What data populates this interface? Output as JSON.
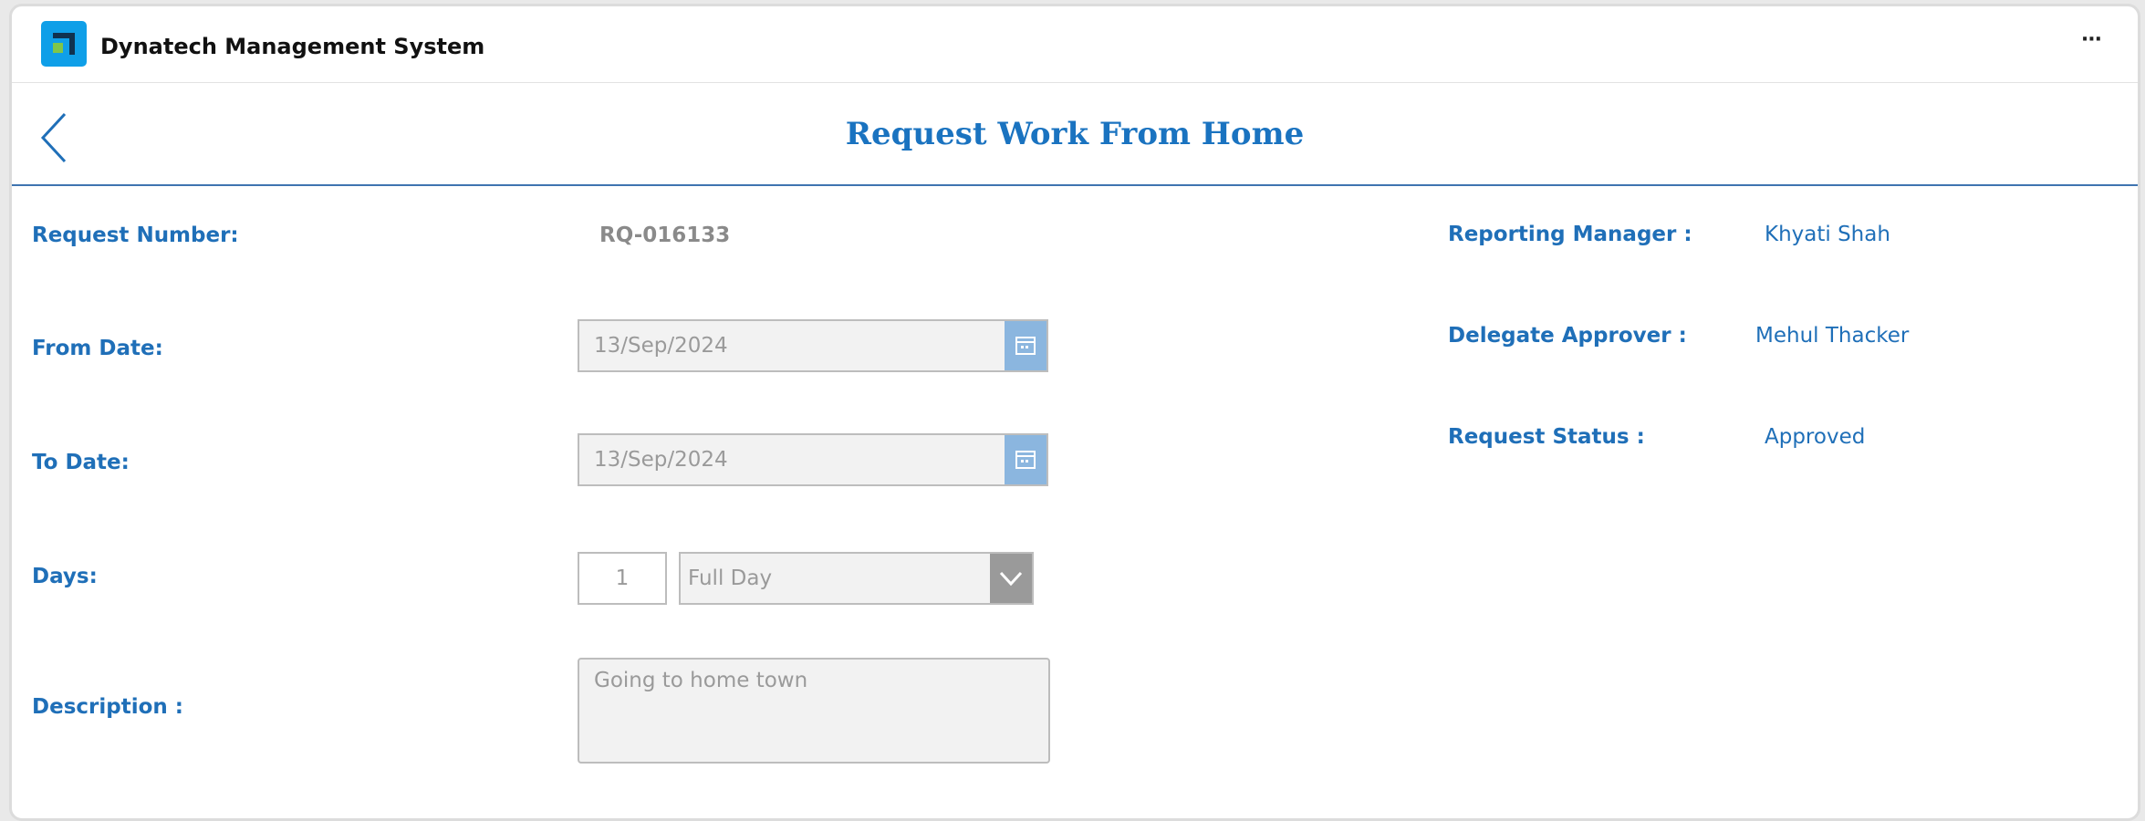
{
  "app": {
    "title": "Dynatech Management System",
    "more_label": "···"
  },
  "header": {
    "title": "Request Work From Home"
  },
  "form": {
    "request_number_label": "Request Number:",
    "request_number_value": "RQ-016133",
    "from_date_label": "From Date:",
    "from_date_value": "13/Sep/2024",
    "to_date_label": "To Date:",
    "to_date_value": "13/Sep/2024",
    "days_label": "Days:",
    "days_value": "1",
    "day_type_value": "Full Day",
    "description_label": "Description :",
    "description_value": "Going to home town"
  },
  "info": {
    "manager_label": "Reporting Manager :",
    "manager_value": "Khyati Shah",
    "delegate_label": "Delegate Approver :",
    "delegate_value": "Mehul Thacker",
    "status_label": "Request Status :",
    "status_value": "Approved"
  },
  "icons": {
    "logo": "app-logo-icon",
    "back": "chevron-left-icon",
    "calendar": "calendar-icon",
    "dropdown": "chevron-down-icon",
    "more": "more-horizontal-icon"
  },
  "colors": {
    "accent": "#1f6fb8",
    "title": "#1a73c0",
    "header_rule": "#3f74b0",
    "calendar_button": "#8bb6df",
    "dropdown_button": "#9a9a9a"
  }
}
